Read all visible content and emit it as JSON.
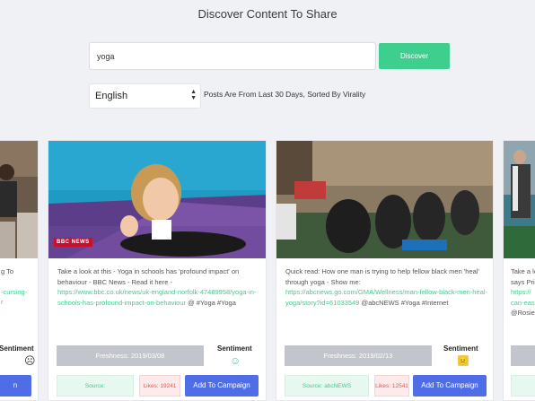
{
  "page": {
    "title": "Discover Content To Share"
  },
  "search": {
    "value": "yoga",
    "button_label": "Discover"
  },
  "language": {
    "selected": "English",
    "note": "Posts Are From Last 30 Days, Sorted By Virality"
  },
  "cards": {
    "partial_left": {
      "desc_line1": "g To",
      "desc_line2": "-cursing-",
      "desc_line3": "r",
      "sentiment_label": "Sentiment",
      "sentiment_icon": "neutral-face-icon",
      "add_label": "n"
    },
    "card1": {
      "image_badge": "BBC NEWS",
      "text": "Take a look at this - Yoga in schools has 'profound impact' on behaviour - BBC News - Read it here -",
      "link": "https://www.bbc.co.uk/news/uk-england-norfolk-47489958/yoga-in-schools-has-profound-impact-on-behaviour",
      "suffix": "@ #Yoga #Yoga",
      "freshness": "Freshness: 2019/03/08",
      "sentiment_label": "Sentiment",
      "sentiment_icon": "smile-face-icon",
      "sentiment_color": "#3ecf8e",
      "source": "Source:",
      "likes": "Likes: 19241",
      "add_label": "Add To Campaign"
    },
    "card2": {
      "text": "Quick read: How one man is trying to help fellow black men 'heal' through yoga - Show me:",
      "link": "https://abcnews.go.com/GMA/Wellness/man-fellow-black-men-heal-yoga/story?id=61033549",
      "suffix": "@abcNEWS #Yoga #Internet",
      "freshness": "Freshness: 2019/02/13",
      "sentiment_label": "Sentiment",
      "sentiment_icon": "neutral-face-icon",
      "sentiment_color": "#f2c94c",
      "source": "Source: abcNEWS",
      "likes": "Likes: 12541",
      "add_label": "Add To Campaign"
    },
    "partial_right": {
      "desc_line1": "Take a lo",
      "desc_line2": "says Pri",
      "desc_line3": "https://",
      "desc_line4": "can-eas",
      "desc_line5": "@RosieT"
    }
  },
  "colors": {
    "accent_green": "#3ecf8e",
    "accent_blue": "#4f6de6",
    "likes_red": "#e45a5a"
  }
}
